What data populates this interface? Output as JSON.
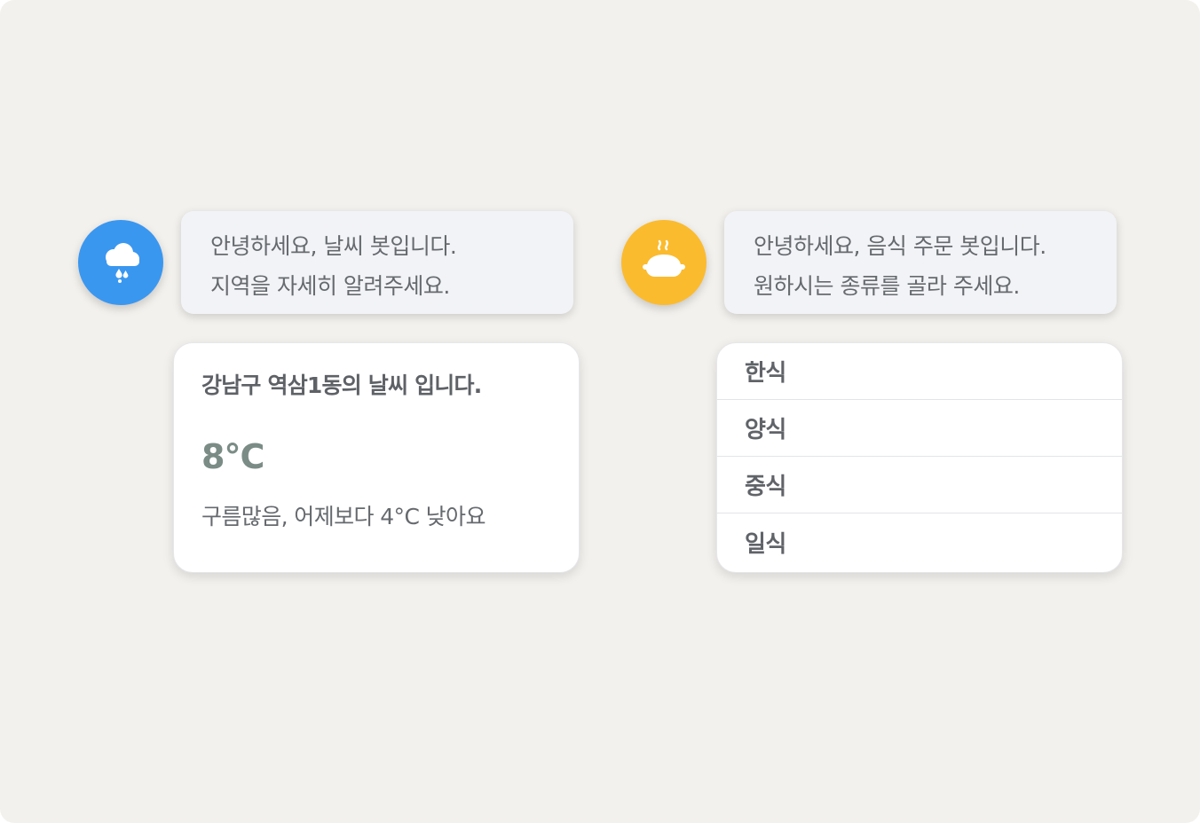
{
  "weather_bot": {
    "avatar_icon": "rain-cloud-icon",
    "avatar_color": "#3a97f0",
    "greeting_line1": "안녕하세요, 날씨 봇입니다.",
    "greeting_line2": "지역을 자세히 알려주세요.",
    "card": {
      "title": "강남구 역삼1동의 날씨 입니다.",
      "temperature": "8°C",
      "description": "구름많음, 어제보다 4°C 낮아요"
    }
  },
  "food_bot": {
    "avatar_icon": "steaming-dish-icon",
    "avatar_color": "#fbbb2e",
    "greeting_line1": "안녕하세요, 음식 주문 봇입니다.",
    "greeting_line2": "원하시는 종류를 골라 주세요.",
    "options": [
      "한식",
      "양식",
      "중식",
      "일식"
    ]
  }
}
